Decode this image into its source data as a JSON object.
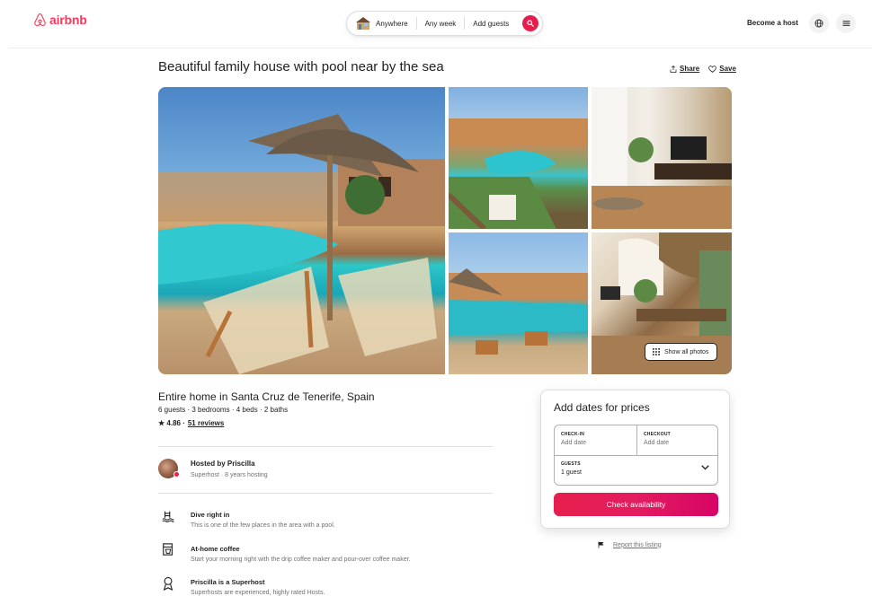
{
  "header": {
    "brand": "airbnb",
    "search": {
      "where": "Anywhere",
      "when": "Any week",
      "guests": "Add guests"
    },
    "become_host": "Become a host"
  },
  "listing": {
    "title": "Beautiful family house with pool near by the sea",
    "share_label": "Share",
    "save_label": "Save",
    "show_all_photos": "Show all photos",
    "type": "Entire home in Santa Cruz de Tenerife, Spain",
    "details": "6 guests · 3 bedrooms · 4 beds · 2 baths",
    "rating": "★ 4.86 ·",
    "reviews": "51 reviews"
  },
  "host": {
    "name": "Hosted by Priscilla",
    "subtitle": "Superhost · 8 years hosting"
  },
  "features": [
    {
      "title": "Dive right in",
      "desc": "This is one of the few places in the area with a pool."
    },
    {
      "title": "At-home coffee",
      "desc": "Start your morning right with the drip coffee maker and pour-over coffee maker."
    },
    {
      "title": "Priscilla is a Superhost",
      "desc": "Superhosts are experienced, highly rated Hosts."
    }
  ],
  "booking": {
    "title": "Add dates for prices",
    "checkin_label": "CHECK-IN",
    "checkin_value": "Add date",
    "checkout_label": "CHECKOUT",
    "checkout_value": "Add date",
    "guests_label": "GUESTS",
    "guests_value": "1 guest",
    "cta": "Check availability"
  },
  "report": "Report this listing",
  "colors": {
    "brand": "#ff385c",
    "cta": "#e61e4d"
  }
}
